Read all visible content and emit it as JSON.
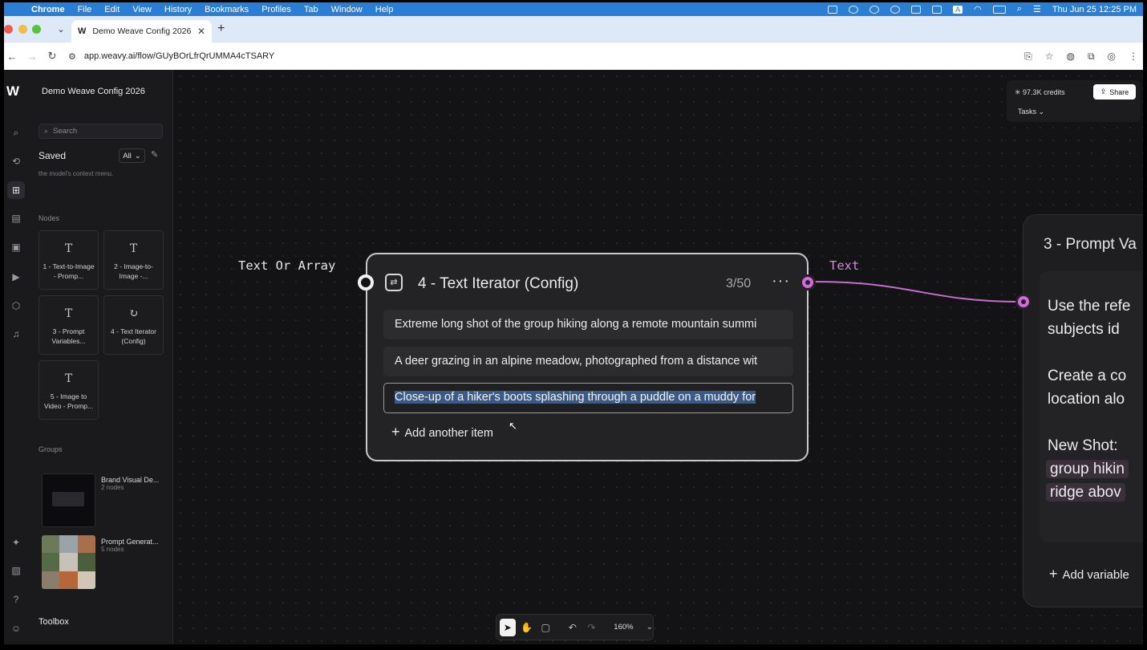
{
  "menubar": {
    "app": "Chrome",
    "items": [
      "File",
      "Edit",
      "View",
      "History",
      "Bookmarks",
      "Profiles",
      "Tab",
      "Window",
      "Help"
    ],
    "status_letter": "A",
    "clock": "Thu Jun 25  12:25 PM"
  },
  "browser": {
    "tab_title": "Demo Weave Config 2026",
    "tab_favicon": "W",
    "url": "app.weavy.ai/flow/GUyBOrLfrQrUMMA4cTSARY"
  },
  "sidebar": {
    "project_title": "Demo Weave Config 2026",
    "search_placeholder": "Search",
    "saved_label": "Saved",
    "filter_value": "All",
    "truncated_text": "the model's context menu.",
    "nodes_label": "Nodes",
    "nodes": [
      {
        "icon": "T",
        "label": "1 - Text-to-Image - Promp..."
      },
      {
        "icon": "T",
        "label": "2 - Image-to-Image -..."
      },
      {
        "icon": "T",
        "label": "3 - Prompt Variables..."
      },
      {
        "icon": "↻",
        "label": "4 - Text Iterator (Config)"
      },
      {
        "icon": "T",
        "label": "5 - Image to Video - Promp..."
      }
    ],
    "groups_label": "Groups",
    "groups": [
      {
        "name": "Brand Visual De...",
        "count": "2 nodes"
      },
      {
        "name": "Prompt Generat...",
        "count": "5 nodes"
      }
    ],
    "toolbox_label": "Toolbox"
  },
  "topright": {
    "credits": "97.3K credits",
    "share_label": "Share",
    "tasks_label": "Tasks"
  },
  "canvas": {
    "input_label": "Text Or Array",
    "output_label": "Text"
  },
  "iterator_node": {
    "title": "4 - Text Iterator (Config)",
    "count": "3/50",
    "items": [
      "Extreme long shot of the group hiking along a remote mountain summi",
      "A deer grazing in an alpine meadow, photographed from a distance wit",
      "Close-up of a hiker's boots splashing through a puddle on a muddy for"
    ],
    "add_label": "Add another item"
  },
  "prompt_node": {
    "title": "3 - Prompt Va",
    "line1": "Use the refe",
    "line2": "subjects id",
    "line3": "Create a co",
    "line4": "location alo",
    "line5": "New Shot:",
    "chip1": "group hikin",
    "chip2": "ridge abov",
    "add_label": "Add variable"
  },
  "bottom_toolbar": {
    "zoom": "160%"
  },
  "colors": {
    "accent_pink": "#d36ad9",
    "selection": "#3b5b86",
    "menubar": "#2a7fd4"
  }
}
